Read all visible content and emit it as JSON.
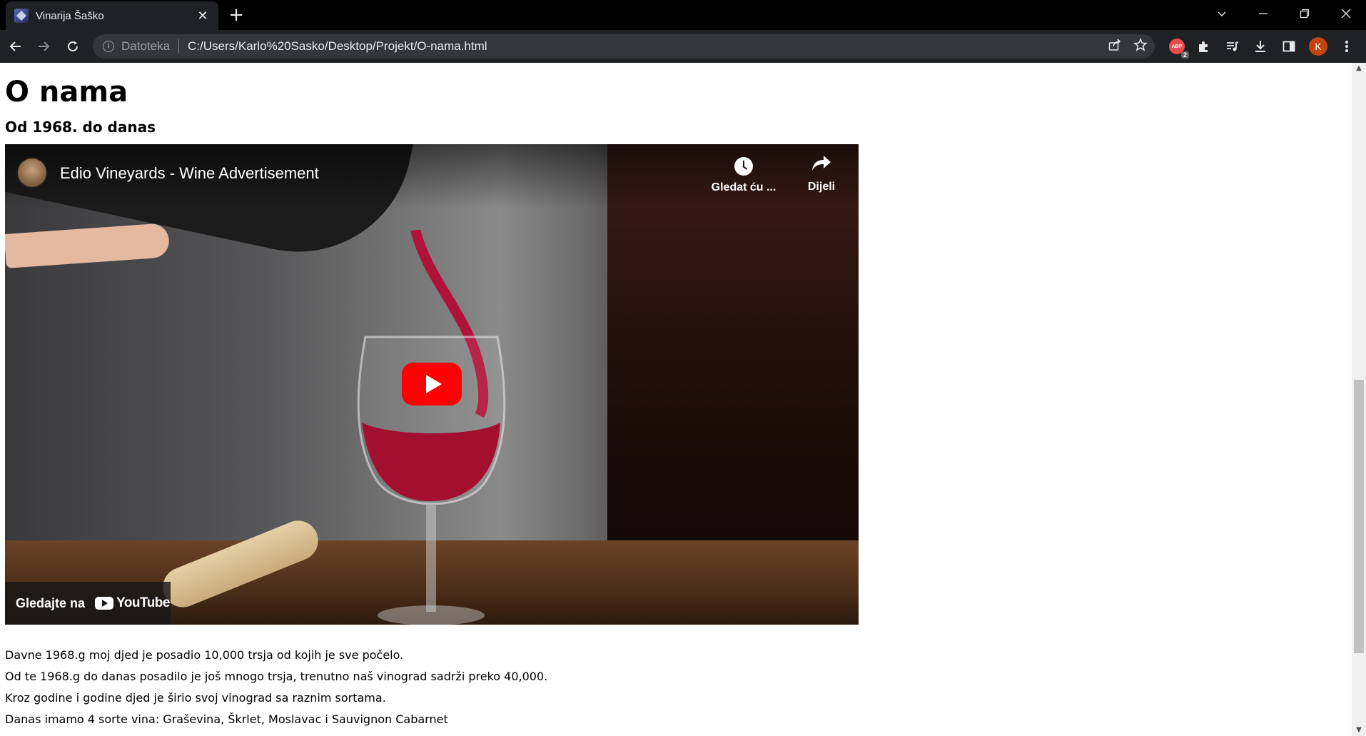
{
  "browser": {
    "tab_title": "Vinarija Šaško",
    "tab_close": "✕",
    "new_tab": "+",
    "scheme_label": "Datoteka",
    "url": "C:/Users/Karlo%20Sasko/Desktop/Projekt/O-nama.html",
    "extension_badge": "2",
    "extension_label": "ABP",
    "profile_initial": "K"
  },
  "page": {
    "title": "O nama",
    "subtitle": "Od 1968. do danas",
    "paragraphs": [
      "Davne 1968.g moj djed je posadio 10,000 trsja od kojih je sve počelo.",
      "Od te 1968.g do danas posadilo je još mnogo trsja, trenutno naš vinograd sadrži preko 40,000.",
      "Kroz godine i godine djed je širio svoj vinograd sa raznim sortama.",
      "Danas imamo 4 sorte vina: Graševina, Škrlet, Moslavac i Sauvignon Cabarnet"
    ]
  },
  "video": {
    "title": "Edio Vineyards - Wine Advertisement",
    "watch_later": "Gledat ću ...",
    "share": "Dijeli",
    "watch_on": "Gledajte na",
    "youtube": "YouTube",
    "play_color": "#ff0000"
  }
}
